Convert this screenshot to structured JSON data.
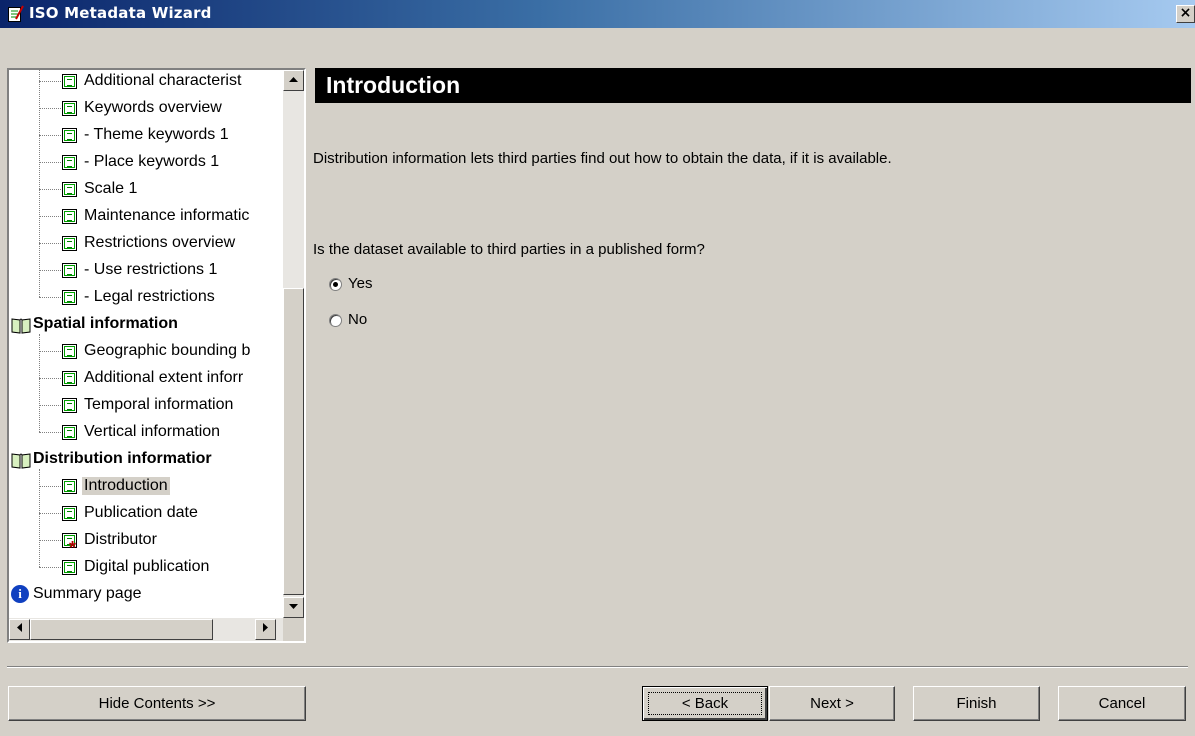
{
  "window": {
    "title": "ISO Metadata Wizard",
    "close_glyph": "×",
    "app_icon": "wizard-icon"
  },
  "tree": {
    "items": [
      {
        "label": "Additional characterist",
        "type": "page"
      },
      {
        "label": "Keywords overview",
        "type": "page"
      },
      {
        "label": "- Theme keywords 1",
        "type": "page"
      },
      {
        "label": "- Place keywords 1",
        "type": "page"
      },
      {
        "label": "Scale 1",
        "type": "page"
      },
      {
        "label": "Maintenance informatic",
        "type": "page"
      },
      {
        "label": "Restrictions overview",
        "type": "page"
      },
      {
        "label": "- Use restrictions 1",
        "type": "page"
      },
      {
        "label": "- Legal restrictions",
        "type": "page"
      },
      {
        "label": "Spatial information",
        "type": "section"
      },
      {
        "label": "Geographic bounding b",
        "type": "page"
      },
      {
        "label": "Additional extent inforr",
        "type": "page"
      },
      {
        "label": "Temporal information",
        "type": "page"
      },
      {
        "label": "Vertical information",
        "type": "page"
      },
      {
        "label": "Distribution informatior",
        "type": "section"
      },
      {
        "label": "Introduction",
        "type": "page",
        "selected": true
      },
      {
        "label": "Publication date",
        "type": "page"
      },
      {
        "label": "Distributor",
        "type": "page",
        "required": true
      },
      {
        "label": "Digital publication",
        "type": "page"
      },
      {
        "label": "Summary page",
        "type": "info"
      }
    ]
  },
  "content": {
    "heading": "Introduction",
    "intro": "Distribution information lets third parties find out how to obtain the data, if it is available.",
    "question": "Is the dataset available to third parties in a published form?",
    "options": [
      {
        "label": "Yes",
        "checked": true
      },
      {
        "label": "No",
        "checked": false
      }
    ]
  },
  "buttons": {
    "hide_contents": "Hide Contents >>",
    "back": "< Back",
    "next": "Next >",
    "finish": "Finish",
    "cancel": "Cancel"
  },
  "colors": {
    "title_gradient_start": "#0a246a",
    "title_gradient_end": "#a6caf0",
    "header_bg": "#000000",
    "window_bg": "#d4d0c8"
  }
}
